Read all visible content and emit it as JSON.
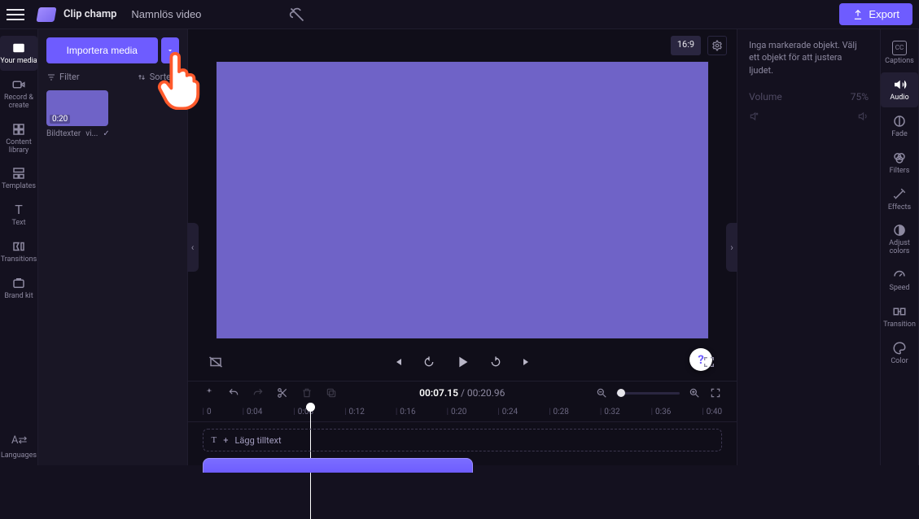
{
  "header": {
    "brand": "Clip champ",
    "title": "Namnlös video",
    "export_label": "Export"
  },
  "left_nav": {
    "items": [
      {
        "label": "Your media"
      },
      {
        "label": "Record & create"
      },
      {
        "label": "Content library"
      },
      {
        "label": "Templates"
      },
      {
        "label": "Text"
      },
      {
        "label": "Transitions"
      },
      {
        "label": "Brand kit"
      }
    ],
    "bottom": {
      "label": "Languages"
    }
  },
  "media_panel": {
    "import_label": "Importera media",
    "filter_label": "Filter",
    "sort_label": "Sortera",
    "thumb_duration": "0:20",
    "thumb_caption": "Bildtexter",
    "thumb_type": "vi..."
  },
  "preview": {
    "aspect": "16:9"
  },
  "inspector": {
    "hint": "Inga markerade objekt. Välj ett objekt för att justera ljudet.",
    "volume_label": "Volume",
    "volume_value": "75%"
  },
  "right_nav": {
    "items": [
      {
        "label": "Captions"
      },
      {
        "label": "Audio"
      },
      {
        "label": "Fade"
      },
      {
        "label": "Filters"
      },
      {
        "label": "Effects"
      },
      {
        "label": "Adjust colors"
      },
      {
        "label": "Speed"
      },
      {
        "label": "Transition"
      },
      {
        "label": "Color"
      }
    ]
  },
  "timeline": {
    "current": "00:07.15",
    "duration": "00:20.96",
    "ticks": [
      "0",
      "0:04",
      "0:08",
      "0:12",
      "0:16",
      "0:20",
      "0:24",
      "0:28",
      "0:32",
      "0:36",
      "0:40"
    ],
    "add_text_label": "Lägg tilltext"
  }
}
